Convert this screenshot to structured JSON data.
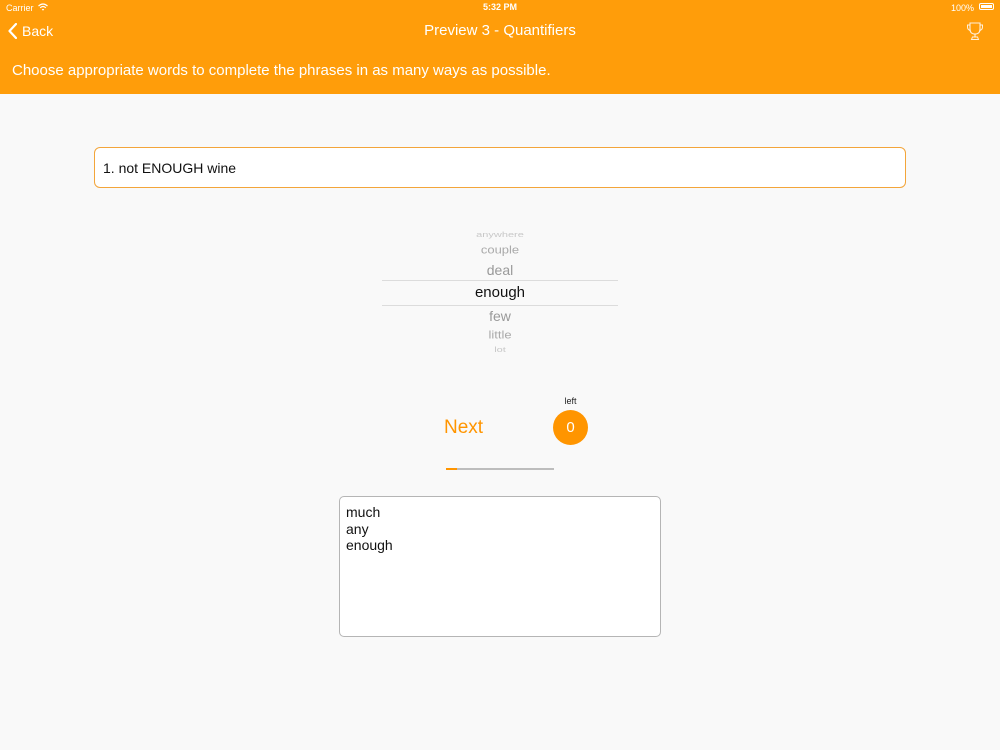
{
  "status_bar": {
    "carrier": "Carrier",
    "time": "5:32 PM",
    "battery": "100%",
    "wifi_icon": "wifi-icon",
    "battery_icon": "battery-icon"
  },
  "nav": {
    "back_label": "Back",
    "title": "Preview 3 - Quantifiers",
    "right_icon": "trophy-icon"
  },
  "instruction": "Choose appropriate words to complete the phrases in as many ways as possible.",
  "question": "1. not ENOUGH wine",
  "picker": {
    "items": [
      "anywhere",
      "couple",
      "deal",
      "enough",
      "few",
      "little",
      "lot"
    ],
    "selected": "enough"
  },
  "controls": {
    "next_label": "Next",
    "left_label": "left",
    "left_count": "0",
    "progress_fraction": 0.1
  },
  "answers": [
    "much",
    "any",
    "enough"
  ],
  "colors": {
    "accent": "#ff9500",
    "header_bg": "#ff9d0a",
    "background": "#f9f9f9"
  }
}
